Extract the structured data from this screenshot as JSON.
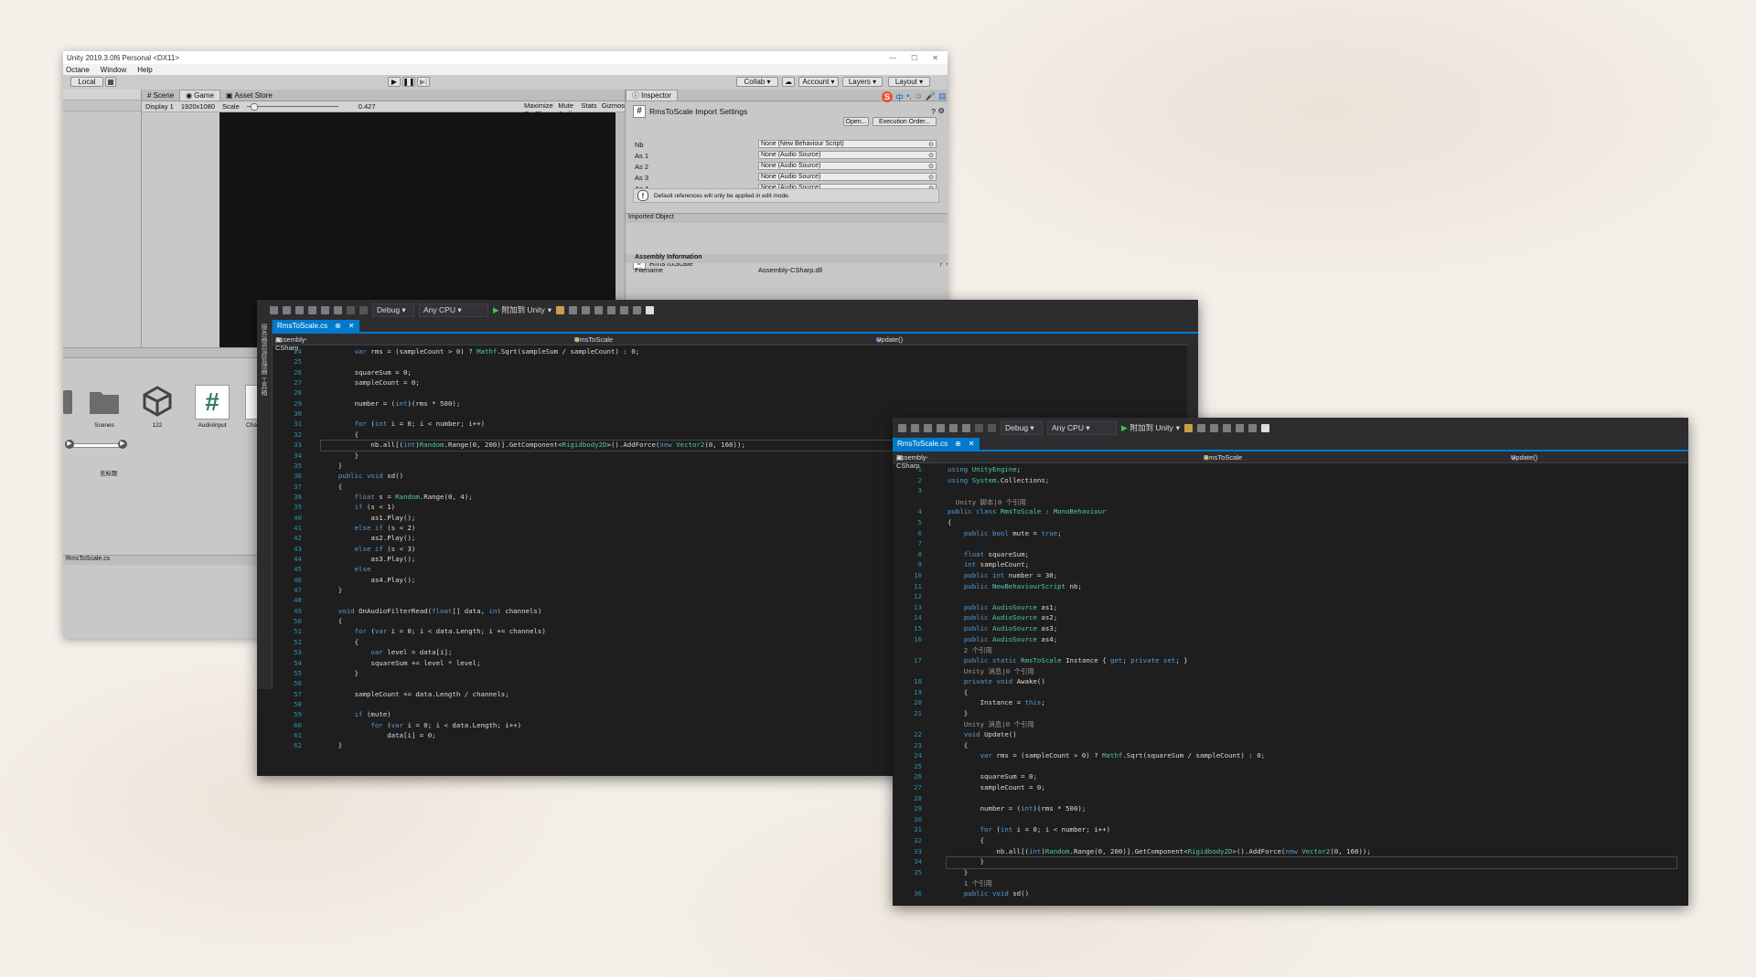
{
  "unity": {
    "title": "Unity 2019.3.0f6 Personal <DX11>",
    "menu": [
      "Octane",
      "Window",
      "Help"
    ],
    "local_label": "Local",
    "collab_label": "Collab",
    "account_label": "Account",
    "layers_label": "Layers",
    "layout_label": "Layout",
    "tabs": {
      "scene": "Scene",
      "game": "Game",
      "asset_store": "Asset Store"
    },
    "game_bar": {
      "display": "Display 1",
      "resolution": "1920x1080",
      "scale_label": "Scale",
      "scale_value": "0.427",
      "maximize": "Maximize On Play",
      "mute": "Mute Audio",
      "stats": "Stats",
      "gizmos": "Gizmos"
    },
    "inspector": {
      "tab_label": "Inspector",
      "title": "RmsToScale Import Settings",
      "open_btn": "Open...",
      "exec_btn": "Execution Order...",
      "props": [
        {
          "label": "Nb",
          "value": "None (New Behaviour Script)"
        },
        {
          "label": "As 1",
          "value": "None (Audio Source)"
        },
        {
          "label": "As 2",
          "value": "None (Audio Source)"
        },
        {
          "label": "As 3",
          "value": "None (Audio Source)"
        },
        {
          "label": "As 4",
          "value": "None (Audio Source)"
        }
      ],
      "note": "Default references will only be applied in edit mode.",
      "imported_object": "Imported Object",
      "script_name": "RmsToScale",
      "assembly_info": "Assembly Information",
      "filename_label": "Filename",
      "filename_value": "Assembly-CSharp.dll"
    },
    "assets": [
      {
        "label": "Scenes"
      },
      {
        "label": "122"
      },
      {
        "label": "AudioInput"
      },
      {
        "label": "Cha"
      }
    ],
    "slider_label": "无标题",
    "footer_file": "RmsToScale.cs"
  },
  "vs_shared": {
    "config": "Debug",
    "platform": "Any CPU",
    "attach": "附加到 Unity",
    "tab": "RmsToScale.cs",
    "nav_project": "Assembly-CSharp",
    "nav_class": "RmsToScale",
    "nav_member": "Update()",
    "sidebar_text": "服务器资源管理器 工具箱"
  },
  "vs1_lines": [
    {
      "n": "24",
      "t": "        var rms = (sampleCount > 0) ? Mathf.Sqrt(sampleSum / sampleCount) : 0;"
    },
    {
      "n": "25",
      "t": ""
    },
    {
      "n": "26",
      "t": "        squareSum = 0;"
    },
    {
      "n": "27",
      "t": "        sampleCount = 0;"
    },
    {
      "n": "28",
      "t": ""
    },
    {
      "n": "29",
      "t": "        number = (int)(rms * 500);"
    },
    {
      "n": "30",
      "t": ""
    },
    {
      "n": "31",
      "t": "        for (int i = 0; i < number; i++)"
    },
    {
      "n": "32",
      "t": "        {"
    },
    {
      "n": "33",
      "t": "            nb.all[(int)Random.Range(0, 200)].GetComponent<Rigidbody2D>().AddForce(new Vector2(0, 160));"
    },
    {
      "n": "34",
      "t": "        }"
    },
    {
      "n": "35",
      "t": "    }"
    },
    {
      "n": "36",
      "t": "    public void sd()"
    },
    {
      "n": "37",
      "t": "    {"
    },
    {
      "n": "38",
      "t": "        float s = Random.Range(0, 4);"
    },
    {
      "n": "39",
      "t": "        if (s < 1)"
    },
    {
      "n": "40",
      "t": "            as1.Play();"
    },
    {
      "n": "41",
      "t": "        else if (s < 2)"
    },
    {
      "n": "42",
      "t": "            as2.Play();"
    },
    {
      "n": "43",
      "t": "        else if (s < 3)"
    },
    {
      "n": "44",
      "t": "            as3.Play();"
    },
    {
      "n": "45",
      "t": "        else"
    },
    {
      "n": "46",
      "t": "            as4.Play();"
    },
    {
      "n": "47",
      "t": "    }"
    },
    {
      "n": "48",
      "t": ""
    },
    {
      "n": "49",
      "t": "    void OnAudioFilterRead(float[] data, int channels)"
    },
    {
      "n": "50",
      "t": "    {"
    },
    {
      "n": "51",
      "t": "        for (var i = 0; i < data.Length; i += channels)"
    },
    {
      "n": "52",
      "t": "        {"
    },
    {
      "n": "53",
      "t": "            var level = data[i];"
    },
    {
      "n": "54",
      "t": "            squareSum += level * level;"
    },
    {
      "n": "55",
      "t": "        }"
    },
    {
      "n": "56",
      "t": ""
    },
    {
      "n": "57",
      "t": "        sampleCount += data.Length / channels;"
    },
    {
      "n": "58",
      "t": ""
    },
    {
      "n": "59",
      "t": "        if (mute)"
    },
    {
      "n": "60",
      "t": "            for (var i = 0; i < data.Length; i++)"
    },
    {
      "n": "61",
      "t": "                data[i] = 0;"
    },
    {
      "n": "62",
      "t": "    }"
    }
  ],
  "vs2_lines": [
    {
      "n": "1",
      "t": "using UnityEngine;"
    },
    {
      "n": "2",
      "t": "using System.Collections;"
    },
    {
      "n": "3",
      "t": ""
    },
    {
      "n": "",
      "t": "  Unity 脚本|0 个引用"
    },
    {
      "n": "4",
      "t": "public class RmsToScale : MonoBehaviour"
    },
    {
      "n": "5",
      "t": "{"
    },
    {
      "n": "6",
      "t": "    public bool mute = true;"
    },
    {
      "n": "7",
      "t": ""
    },
    {
      "n": "8",
      "t": "    float squareSum;"
    },
    {
      "n": "9",
      "t": "    int sampleCount;"
    },
    {
      "n": "10",
      "t": "    public int number = 30;"
    },
    {
      "n": "11",
      "t": "    public NewBehaviourScript nb;"
    },
    {
      "n": "12",
      "t": ""
    },
    {
      "n": "13",
      "t": "    public AudioSource as1;"
    },
    {
      "n": "14",
      "t": "    public AudioSource as2;"
    },
    {
      "n": "15",
      "t": "    public AudioSource as3;"
    },
    {
      "n": "16",
      "t": "    public AudioSource as4;"
    },
    {
      "n": "",
      "t": "    2 个引用"
    },
    {
      "n": "17",
      "t": "    public static RmsToScale Instance { get; private set; }"
    },
    {
      "n": "",
      "t": "    Unity 消息|0 个引用"
    },
    {
      "n": "18",
      "t": "    private void Awake()"
    },
    {
      "n": "19",
      "t": "    {"
    },
    {
      "n": "20",
      "t": "        Instance = this;"
    },
    {
      "n": "21",
      "t": "    }"
    },
    {
      "n": "",
      "t": "    Unity 消息|0 个引用"
    },
    {
      "n": "22",
      "t": "    void Update()"
    },
    {
      "n": "23",
      "t": "    {"
    },
    {
      "n": "24",
      "t": "        var rms = (sampleCount > 0) ? Mathf.Sqrt(squareSum / sampleCount) : 0;"
    },
    {
      "n": "25",
      "t": ""
    },
    {
      "n": "26",
      "t": "        squareSum = 0;"
    },
    {
      "n": "27",
      "t": "        sampleCount = 0;"
    },
    {
      "n": "28",
      "t": ""
    },
    {
      "n": "29",
      "t": "        number = (int)(rms * 500);"
    },
    {
      "n": "30",
      "t": ""
    },
    {
      "n": "31",
      "t": "        for (int i = 0; i < number; i++)"
    },
    {
      "n": "32",
      "t": "        {"
    },
    {
      "n": "33",
      "t": "            nb.all[(int)Random.Range(0, 200)].GetComponent<Rigidbody2D>().AddForce(new Vector2(0, 160));"
    },
    {
      "n": "34",
      "t": "        }"
    },
    {
      "n": "35",
      "t": "    }"
    },
    {
      "n": "",
      "t": "    1 个引用"
    },
    {
      "n": "36",
      "t": "    public void sd()"
    }
  ]
}
